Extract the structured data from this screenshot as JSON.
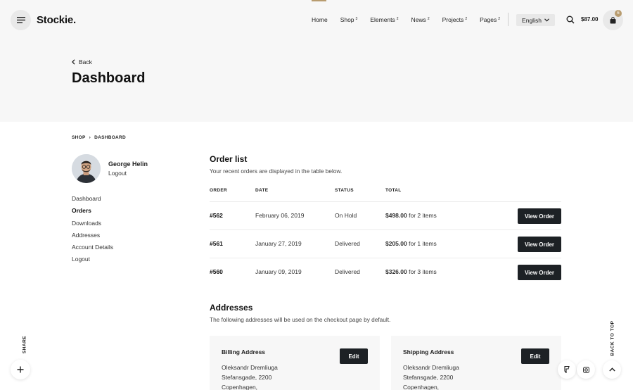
{
  "header": {
    "logo": "Stockie.",
    "nav": [
      {
        "label": "Home",
        "sup": ""
      },
      {
        "label": "Shop",
        "sup": "3"
      },
      {
        "label": "Elements",
        "sup": "2"
      },
      {
        "label": "News",
        "sup": "2"
      },
      {
        "label": "Projects",
        "sup": "2"
      },
      {
        "label": "Pages",
        "sup": "2"
      }
    ],
    "language": "English",
    "cart_total": "$87.00",
    "cart_count": "6",
    "icons": {
      "menu": "hamburger-icon",
      "search": "search-icon",
      "cart": "shopping-bag-icon"
    }
  },
  "page": {
    "back_label": "Back",
    "title": "Dashboard"
  },
  "breadcrumb": [
    "SHOP",
    "DASHBOARD"
  ],
  "user": {
    "name": "George Helin",
    "logout": "Logout"
  },
  "side_menu": [
    {
      "label": "Dashboard",
      "active": false
    },
    {
      "label": "Orders",
      "active": true
    },
    {
      "label": "Downloads",
      "active": false
    },
    {
      "label": "Addresses",
      "active": false
    },
    {
      "label": "Account Details",
      "active": false
    },
    {
      "label": "Logout",
      "active": false
    }
  ],
  "orders": {
    "title": "Order list",
    "subtitle": "Your recent orders are displayed in the table below.",
    "columns": [
      "ORDER",
      "DATE",
      "STATUS",
      "TOTAL"
    ],
    "rows": [
      {
        "order": "#562",
        "date": "February 06, 2019",
        "status": "On Hold",
        "total": "$498.00",
        "items": "for 2 items",
        "action": "View Order"
      },
      {
        "order": "#561",
        "date": "January 27, 2019",
        "status": "Delivered",
        "total": "$205.00",
        "items": "for 1 items",
        "action": "View Order"
      },
      {
        "order": "#560",
        "date": "January 09, 2019",
        "status": "Delivered",
        "total": "$326.00",
        "items": "for 3 items",
        "action": "View Order"
      }
    ]
  },
  "addresses": {
    "title": "Addresses",
    "subtitle": "The following addresses will be used on the checkout page by default.",
    "cards": [
      {
        "title": "Billing Address",
        "edit": "Edit",
        "lines": [
          "Oleksandr Dremliuga",
          "Stefansgade, 2200",
          "Copenhagen,"
        ]
      },
      {
        "title": "Shipping Address",
        "edit": "Edit",
        "lines": [
          "Oleksandr Dremliuga",
          "Stefansgade, 2200",
          "Copenhagen,"
        ]
      }
    ]
  },
  "floating": {
    "share": "SHARE",
    "back_to_top": "BACK TO TOP"
  },
  "colors": {
    "accent": "#b89c6f",
    "button": "#1d2125",
    "header_bg": "#f7f7f7"
  }
}
